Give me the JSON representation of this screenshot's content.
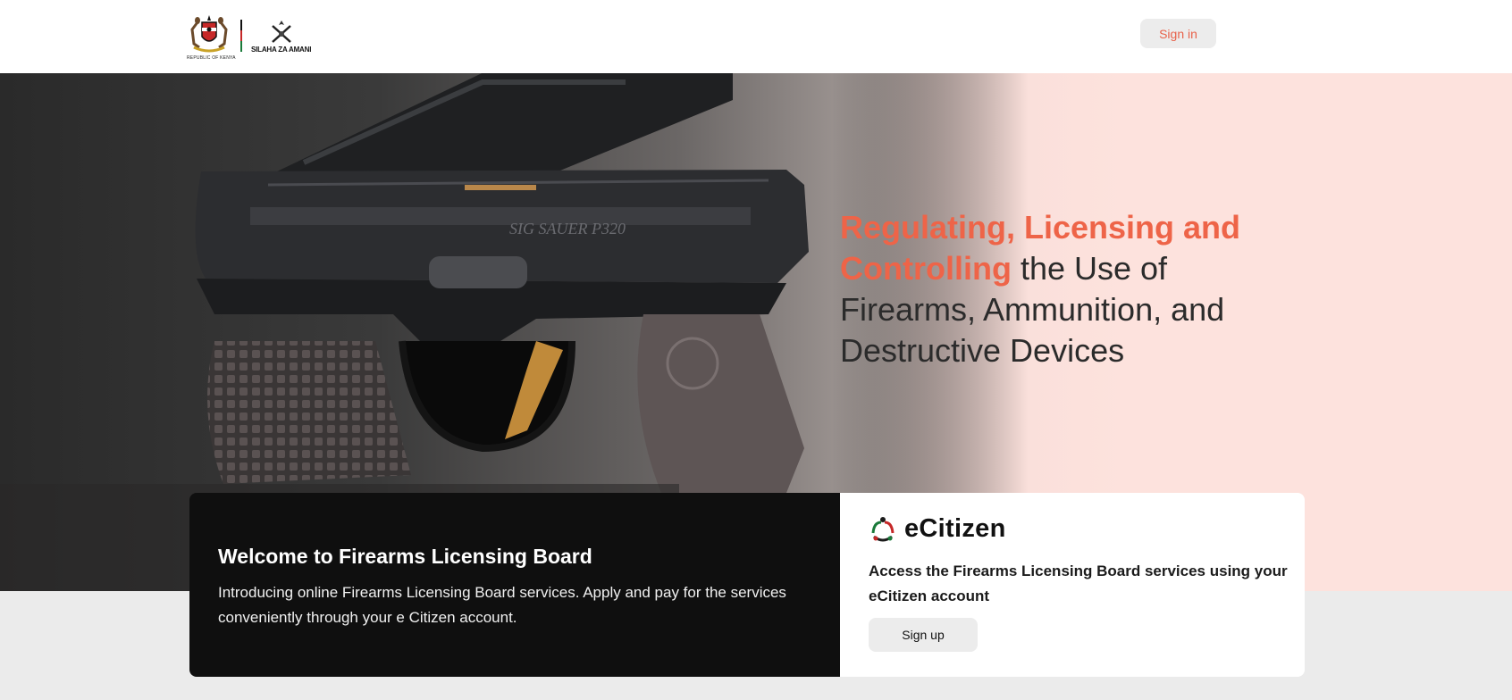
{
  "header": {
    "coat_of_arms_caption": "REPUBLIC OF KENYA",
    "logo_caption": "SILAHA ZA AMANI",
    "signin_label": "Sign in"
  },
  "hero": {
    "headline_accent": "Regulating, Licensing and Controlling",
    "headline_rest": " the Use of Firearms, Ammunition, and Destructive Devices",
    "image_icon": "handgun-photo"
  },
  "welcome_card": {
    "title": "Welcome to Firearms Licensing Board",
    "text": "Introducing online Firearms Licensing Board services. Apply and pay for the services conveniently through your e Citizen account."
  },
  "ecitizen_card": {
    "brand": "eCitizen",
    "text": "Access the Firearms Licensing Board services using your eCitizen account",
    "signup_label": "Sign up"
  },
  "colors": {
    "accent": "#ee6448",
    "hero_pink": "#fde2dd",
    "dark_card": "#0f0f0f"
  }
}
